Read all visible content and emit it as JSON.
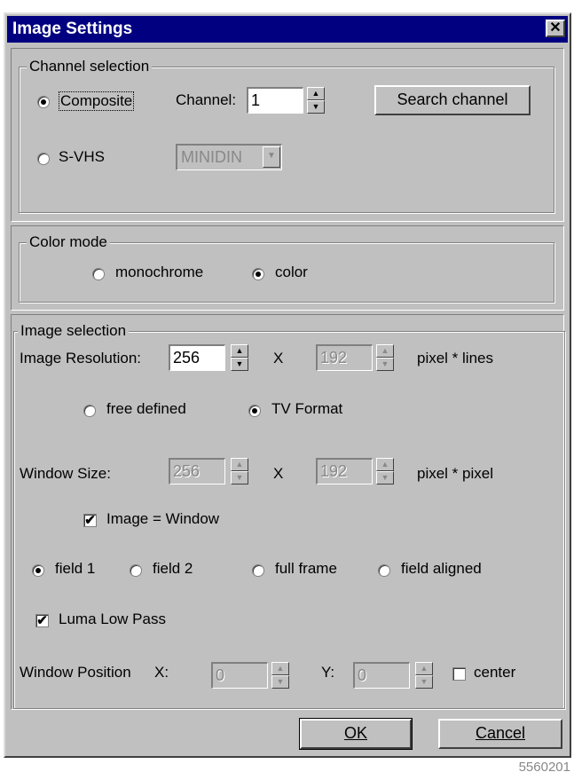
{
  "window": {
    "title": "Image Settings",
    "close_glyph": "✕"
  },
  "channel_selection": {
    "legend": "Channel selection",
    "composite_label": "Composite",
    "composite_selected": true,
    "channel_label": "Channel:",
    "channel_value": "1",
    "search_button": "Search channel",
    "svhs_label": "S-VHS",
    "svhs_selected": false,
    "connector_value": "MINIDIN"
  },
  "color_mode": {
    "legend": "Color mode",
    "monochrome_label": "monochrome",
    "color_label": "color",
    "selected": "color"
  },
  "image_selection": {
    "legend": "Image selection",
    "resolution_label": "Image Resolution:",
    "resolution_width": "256",
    "resolution_height": "192",
    "times_sign": "X",
    "resolution_unit": "pixel * lines",
    "free_defined_label": "free defined",
    "tv_format_label": "TV Format",
    "format_selected": "TV Format",
    "window_size_label": "Window Size:",
    "window_width": "256",
    "window_height": "192",
    "window_unit": "pixel * pixel",
    "image_equals_window_label": "Image = Window",
    "image_equals_window_checked": true,
    "field_options": [
      "field 1",
      "field 2",
      "full frame",
      "field aligned"
    ],
    "field_selected": "field 1",
    "luma_low_pass_label": "Luma Low Pass",
    "luma_low_pass_checked": true,
    "window_position_label": "Window Position",
    "x_label": "X:",
    "x_value": "0",
    "y_label": "Y:",
    "y_value": "0",
    "center_label": "center",
    "center_checked": false
  },
  "buttons": {
    "ok": "OK",
    "cancel": "Cancel"
  },
  "image_id": "5560201",
  "icons": {
    "check": "✔",
    "spin_up": "▲",
    "spin_down": "▼",
    "dropdown": "▼"
  }
}
